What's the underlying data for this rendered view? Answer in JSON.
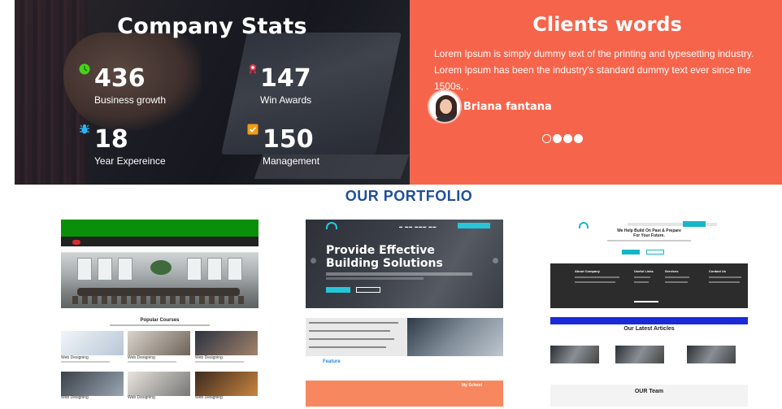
{
  "stats": {
    "title": "Company Stats",
    "items": [
      {
        "value": "436",
        "label": "Business growth",
        "icon": "growth-icon",
        "icon_color": "#46d21a"
      },
      {
        "value": "147",
        "label": "Win Awards",
        "icon": "award-icon",
        "icon_color": "#e8344e"
      },
      {
        "value": "18",
        "label": "Year Expereince",
        "icon": "bug-icon",
        "icon_color": "#29b6f6"
      },
      {
        "value": "150",
        "label": "Management",
        "icon": "checkbox-icon",
        "icon_color": "#f39c12"
      }
    ]
  },
  "clients": {
    "title": "Clients words",
    "text": "Lorem Ipsum is simply dummy text of the printing and typesetting industry. Lorem Ipsum has been the industry's standard dummy text ever since the 1500s, .",
    "name": "Briana fantana",
    "carousel": {
      "count": 4,
      "active": 0
    },
    "background": "#f6654b"
  },
  "portfolio": {
    "title": "OUR PORTFOLIO",
    "title_color": "#1f4f9b",
    "thumb1": {
      "section_title": "Popular Courses",
      "card_label": "Web Designing"
    },
    "thumb2": {
      "headline_1": "Provide Effective",
      "headline_2": "Building Solutions",
      "section_title": "Feature",
      "footer_heading": "My School"
    },
    "thumb3": {
      "headline_1": "We Help Build On Past & Prepare",
      "headline_2": "For Your Future.",
      "articles_title": "Our Latest Articles",
      "team_title": "OUR Team",
      "footer_cols": [
        "About Company",
        "Useful Links",
        "Services",
        "Contact Us"
      ]
    }
  }
}
